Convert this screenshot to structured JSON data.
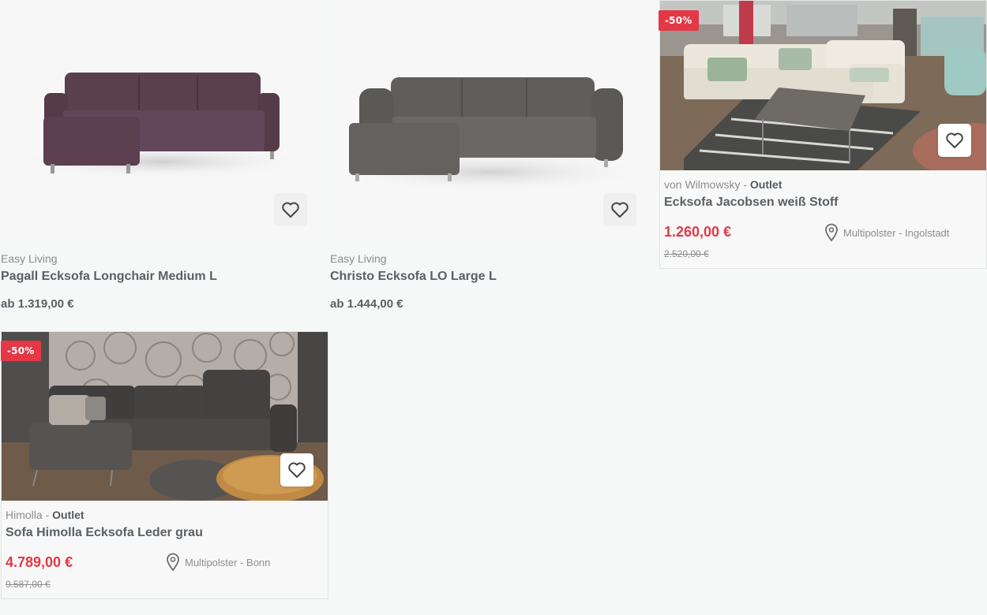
{
  "products": [
    {
      "brand": "Easy Living",
      "brand_suffix": "",
      "title": "Pagall Ecksofa Longchair Medium L",
      "price": "ab 1.319,00 €",
      "image": "corner-sofa-aubergine"
    },
    {
      "brand": "Easy Living",
      "brand_suffix": "",
      "title": "Christo Ecksofa LO Large L",
      "price": "ab 1.444,00 €",
      "image": "corner-sofa-grey"
    },
    {
      "badge": "-50%",
      "brand": "von Wilmowsky",
      "brand_sep": " - ",
      "brand_suffix": "Outlet",
      "title": "Ecksofa Jacobsen weiß Stoff",
      "sale_price": "1.260,00 €",
      "old_price": "2.520,00 €",
      "location": "Multipolster - Ingolstadt",
      "image": "showroom-white-corner-sofa"
    },
    {
      "badge": "-50%",
      "brand": "Himolla",
      "brand_sep": " - ",
      "brand_suffix": "Outlet",
      "title": "Sofa Himolla Ecksofa Leder grau",
      "sale_price": "4.789,00 €",
      "old_price": "9.587,00 €",
      "location": "Multipolster - Bonn",
      "image": "showroom-grey-leather-sofa"
    }
  ],
  "icons": {
    "favorite": "heart-outline-icon",
    "location": "map-pin-icon"
  },
  "colors": {
    "sale": "#e53846",
    "text": "#5b6064",
    "muted": "#8a8d8f"
  }
}
